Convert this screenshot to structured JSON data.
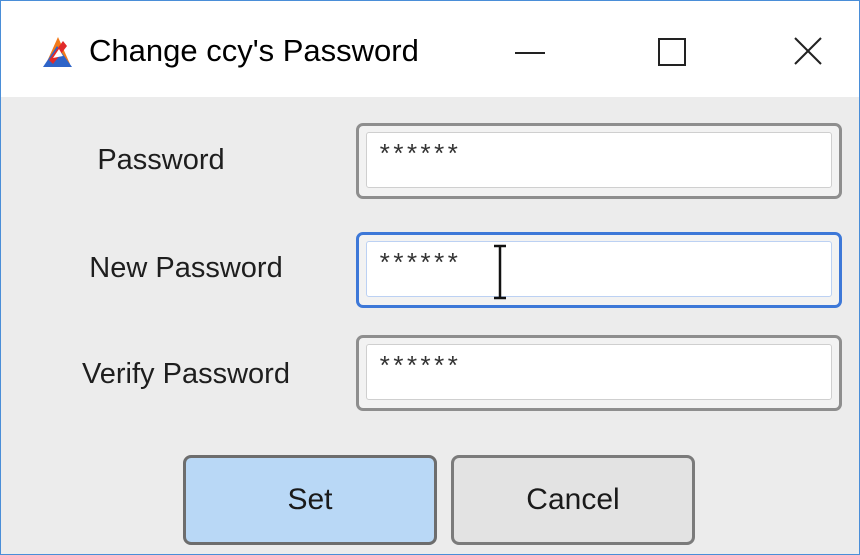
{
  "window": {
    "title": "Change ccy's Password",
    "icons": {
      "app": "app-logo-icon",
      "minimize": "minimize-icon",
      "maximize": "maximize-icon",
      "close": "close-icon"
    },
    "colors": {
      "border_accent": "#4a8ed8",
      "focus": "#3d78d8",
      "default_button": "#b9d8f6"
    }
  },
  "form": {
    "password": {
      "label": "Password",
      "value": "******"
    },
    "new_password": {
      "label": "New Password",
      "value": "******"
    },
    "verify_password": {
      "label": "Verify Password",
      "value": "******"
    }
  },
  "buttons": {
    "set": "Set",
    "cancel": "Cancel"
  },
  "cursor": {
    "icon": "text-cursor-icon"
  }
}
